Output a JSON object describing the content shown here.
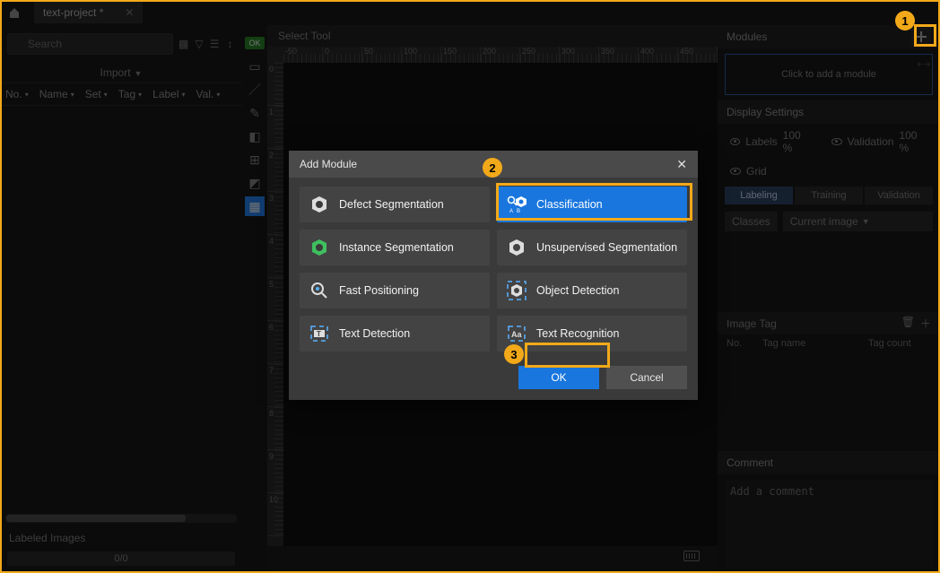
{
  "tab": {
    "title": "text-project *"
  },
  "left": {
    "search_placeholder": "Search",
    "import_label": "Import",
    "headers": [
      "No.",
      "Name",
      "Set",
      "Tag",
      "Label",
      "Val."
    ],
    "labeled_images": "Labeled Images",
    "progress": "0/0",
    "ok_badge": "OK"
  },
  "center": {
    "select_tool": "Select Tool",
    "ruler_h": [
      -50,
      0,
      50,
      100,
      150,
      200,
      250,
      300,
      350,
      400,
      450
    ],
    "ruler_v": [
      0,
      1,
      2,
      3,
      4,
      5,
      6,
      7,
      8,
      9,
      10
    ]
  },
  "right": {
    "modules_label": "Modules",
    "placeholder": "Click to add a module",
    "display_settings": "Display Settings",
    "row1_a": "Labels",
    "row1_a_val": "100 %",
    "row1_b": "Validation",
    "row1_b_val": "100 %",
    "row2_a": "Grid",
    "modes": [
      "Labeling",
      "Training",
      "Validation"
    ],
    "classes_label": "Classes",
    "current_image": "Current image",
    "image_tag": "Image Tag",
    "tag_cols": [
      "No.",
      "Tag name",
      "Tag count"
    ],
    "comment": "Comment",
    "comment_placeholder": "Add a comment"
  },
  "modal": {
    "title": "Add Module",
    "cards": [
      "Defect Segmentation",
      "Classification",
      "Instance Segmentation",
      "Unsupervised Segmentation",
      "Fast Positioning",
      "Object Detection",
      "Text Detection",
      "Text Recognition"
    ],
    "ok": "OK",
    "cancel": "Cancel"
  },
  "callouts": {
    "c1": "1",
    "c2": "2",
    "c3": "3"
  }
}
